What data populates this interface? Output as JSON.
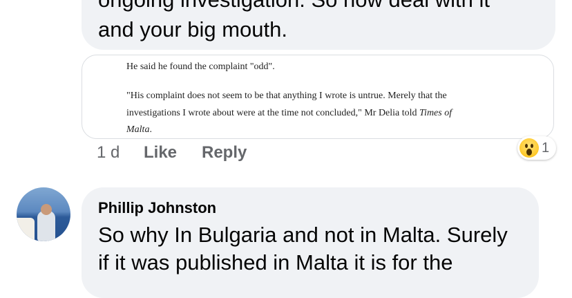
{
  "comment1": {
    "partial_line": "ongoing investigation. So now deal with it",
    "line2": "and your big mouth.",
    "embed": {
      "p1": "He said he found the complaint \"odd\".",
      "p2": "\"His complaint does not seem to be that anything I wrote is untrue. Merely that the",
      "p3_prefix": "investigations I wrote about were at the time not concluded,\" Mr Delia told ",
      "p3_italic": "Times of",
      "p4_italic": "Malta",
      "p4_suffix": "."
    },
    "actions": {
      "time": "1 d",
      "like": "Like",
      "reply": "Reply"
    },
    "reaction": {
      "icon": "wow-reaction-icon",
      "count": "1"
    }
  },
  "comment2": {
    "author": "Phillip Johnston",
    "line1": "So why In Bulgaria and not in Malta. Surely",
    "line2": "if it was published in Malta it is for the"
  },
  "colors": {
    "bubble": "#f0f2f5",
    "secondary_text": "#65676b"
  }
}
